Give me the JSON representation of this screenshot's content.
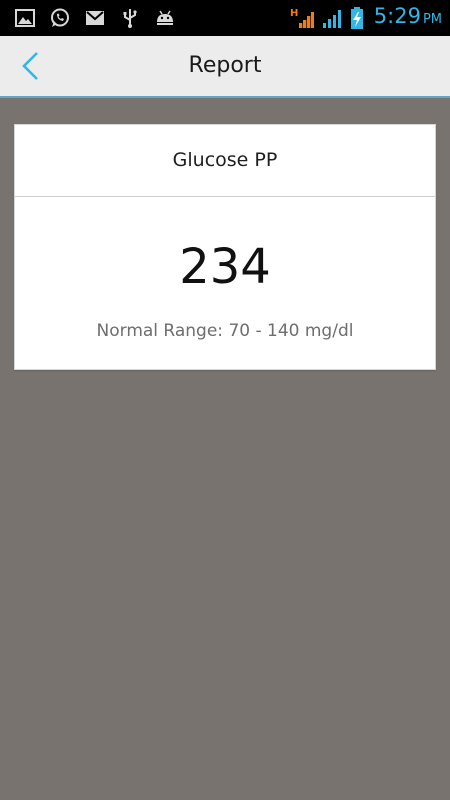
{
  "status_bar": {
    "icons_left": [
      "image-icon",
      "whatsapp-icon",
      "mail-icon",
      "usb-icon",
      "android-debug-icon"
    ],
    "icons_right": [
      "hspa-signal-icon",
      "signal-strength-icon",
      "battery-charging-icon"
    ],
    "time": "5:29",
    "ampm": "PM",
    "clock_color": "#33b5e5",
    "network_type": "H"
  },
  "action_bar": {
    "title": "Report",
    "back_icon": "chevron-left-icon",
    "accent_color": "#33b5e5"
  },
  "report_card": {
    "test_name": "Glucose PP",
    "value": "234",
    "normal_range": "Normal Range: 70 - 140 mg/dl"
  }
}
